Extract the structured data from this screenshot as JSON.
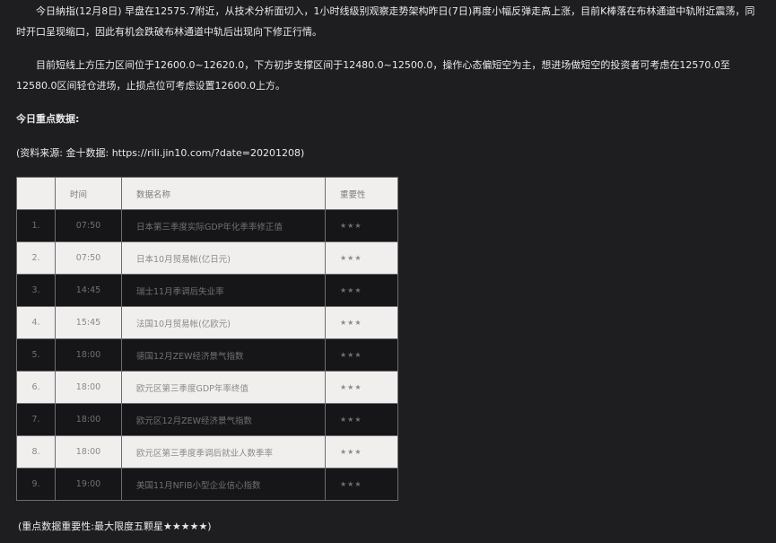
{
  "paragraphs": {
    "p1": "今日納指(12月8日) 早盘在12575.7附近，从技术分析面切入，1小时线级别观察走势架构昨日(7日)再度小幅反弹走高上涨，目前K棒落在布林通道中轨附近震荡，同时开口呈现缩口，因此有机会跌破布林通道中轨后出现向下修正行情。",
    "p2": "目前短线上方压力区间位于12600.0~12620.0，下方初步支撑区间于12480.0~12500.0，操作心态偏短空为主，想进场做短空的投资者可考虑在12570.0至12580.0区间轻仓进场，止损点位可考虑设置12600.0上方。"
  },
  "heading": "今日重点数据:",
  "source": {
    "prefix": "(资料来源: 金十数据: ",
    "url": "https://rili.jin10.com/?date=20201208",
    "suffix": ")"
  },
  "table": {
    "headers": {
      "no": "",
      "time": "时间",
      "name": "数据名称",
      "importance": "重要性"
    },
    "rows": [
      {
        "no": "1.",
        "time": "07:50",
        "name": "日本第三季度实际GDP年化季率修正值",
        "importance": "★★★"
      },
      {
        "no": "2.",
        "time": "07:50",
        "name": "日本10月贸易帐(亿日元)",
        "importance": "★★★"
      },
      {
        "no": "3.",
        "time": "14:45",
        "name": "瑞士11月季调后失业率",
        "importance": "★★★"
      },
      {
        "no": "4.",
        "time": "15:45",
        "name": "法国10月贸易帐(亿欧元)",
        "importance": "★★★"
      },
      {
        "no": "5.",
        "time": "18:00",
        "name": "德国12月ZEW经济景气指数",
        "importance": "★★★"
      },
      {
        "no": "6.",
        "time": "18:00",
        "name": "欧元区第三季度GDP年率终值",
        "importance": "★★★"
      },
      {
        "no": "7.",
        "time": "18:00",
        "name": "欧元区12月ZEW经济景气指数",
        "importance": "★★★"
      },
      {
        "no": "8.",
        "time": "18:00",
        "name": "欧元区第三季度季调后就业人数季率",
        "importance": "★★★"
      },
      {
        "no": "9.",
        "time": "19:00",
        "name": "美国11月NFIB小型企业信心指数",
        "importance": "★★★"
      }
    ]
  },
  "footnote": "(重点数据重要性:最大限度五颗星★★★★★)",
  "colors": {
    "background": "#1e1e21",
    "text": "#e9e9ea",
    "row_light": "#f0efed",
    "row_dark": "#161619"
  }
}
